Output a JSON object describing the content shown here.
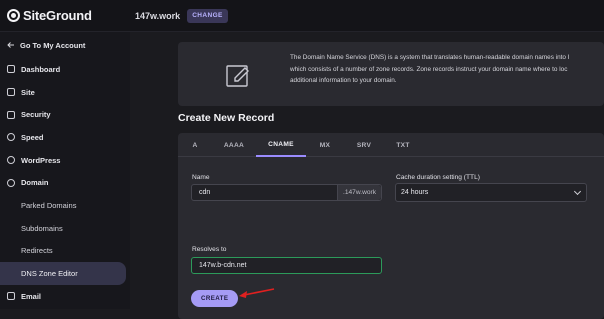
{
  "header": {
    "logo_text": "SiteGround",
    "site_name": "147w.work",
    "change_label": "CHANGE"
  },
  "sidebar": {
    "back_label": "Go To My Account",
    "items": [
      {
        "label": "Dashboard",
        "icon": "dashboard-icon"
      },
      {
        "label": "Site",
        "icon": "site-icon"
      },
      {
        "label": "Security",
        "icon": "lock-icon"
      },
      {
        "label": "Speed",
        "icon": "rocket-icon"
      },
      {
        "label": "WordPress",
        "icon": "wordpress-icon"
      },
      {
        "label": "Domain",
        "icon": "globe-icon"
      }
    ],
    "sub_items": [
      "Parked Domains",
      "Subdomains",
      "Redirects",
      "DNS Zone Editor"
    ],
    "email_label": "Email"
  },
  "info": {
    "line1": "The Domain Name Service (DNS) is a system that translates human-readable domain names into I",
    "line2": "which consists of a number of zone records. Zone records instruct your domain name where to loc",
    "line3": "additional information to your domain."
  },
  "create_record": {
    "title": "Create New Record",
    "tabs": [
      "A",
      "AAAA",
      "CNAME",
      "MX",
      "SRV",
      "TXT"
    ],
    "active_tab": "CNAME",
    "name_label": "Name",
    "name_value": "cdn",
    "name_suffix": ".147w.work",
    "ttl_label": "Cache duration setting (TTL)",
    "ttl_value": "24 hours",
    "resolves_label": "Resolves to",
    "resolves_value": "147w.b-cdn.net",
    "create_label": "CREATE"
  },
  "colors": {
    "accent": "#a59bf5",
    "valid_border": "#2c9a5a",
    "annotation_arrow": "#e02020"
  }
}
